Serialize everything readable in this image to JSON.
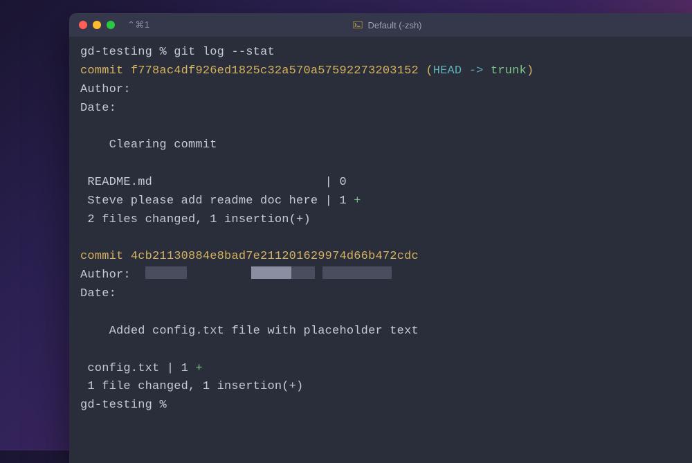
{
  "titlebar": {
    "shortcut": "⌃⌘1",
    "tab_label": "Default (-zsh)"
  },
  "prompt": {
    "dir": "gd-testing",
    "symbol": "%",
    "command": "git log --stat"
  },
  "commits": [
    {
      "commit_label": "commit",
      "hash": "f778ac4df926ed1825c32a570a57592273203152",
      "ref_open": "(",
      "ref_head": "HEAD -> ",
      "ref_branch": "trunk",
      "ref_close": ")",
      "author_label": "Author:",
      "date_label": "Date:",
      "message": "Clearing commit",
      "stat_lines": [
        {
          "file": " README.md                        | 0",
          "plus": ""
        },
        {
          "file": " Steve please add readme doc here | 1 ",
          "plus": "+"
        }
      ],
      "summary": " 2 files changed, 1 insertion(+)"
    },
    {
      "commit_label": "commit",
      "hash": "4cb21130884e8bad7e211201629974d66b472cdc",
      "author_label": "Author:  ",
      "date_label": "Date:",
      "message": "Added config.txt file with placeholder text",
      "stat_lines": [
        {
          "file": " config.txt | 1 ",
          "plus": "+"
        }
      ],
      "summary": " 1 file changed, 1 insertion(+)"
    }
  ],
  "trailing_prompt": {
    "dir": "gd-testing",
    "symbol": "%"
  },
  "colors": {
    "window_bg": "#2a2d3a",
    "titlebar_bg": "#35384a",
    "text": "#c5cad8",
    "yellow": "#d4b25f",
    "cyan": "#5fb0b8",
    "green": "#7cc48a"
  }
}
